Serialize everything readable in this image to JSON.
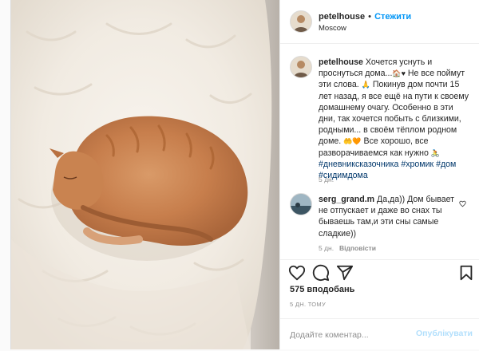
{
  "post": {
    "username": "petelhouse",
    "follow_label": "Стежити",
    "location": "Moscow",
    "caption": {
      "username": "petelhouse",
      "line1": "Хочется уснуть и проснуться дома...",
      "line1b": "Не все поймут эти слова.",
      "line2": "Покинув дом почти 15 лет назад, я все ещё на пути к своему домашнему очагу. Особенно в эти дни, так хочется побыть с близкими, родными... в своём тёплом родном доме.",
      "line3": "Все хорошо, все разворачиваемся как нужно",
      "tags": [
        "#дневниксказочника",
        "#хромик",
        "#дом",
        "#сидимдома"
      ],
      "age": "5 дн."
    },
    "comment": {
      "username": "serg_grand.m",
      "text": "Да,да)) Дом бывает не отпускает и даже во снах ты бываешь там,и эти сны самые сладкие))",
      "age": "5 дн.",
      "reply_label": "Відповісти"
    },
    "likes": "575 вподобань",
    "time_ago": "5 ДН. ТОМУ",
    "add_comment_placeholder": "Додайте коментар...",
    "post_button": "Опублікувати"
  },
  "icons": [
    "heart-icon",
    "comment-icon",
    "share-icon",
    "bookmark-icon",
    "comment-like-icon"
  ],
  "colors": {
    "link": "#0095f6",
    "hashtag": "#00376b",
    "muted": "#8e8e8e",
    "post_disabled": "#b2dffc"
  }
}
